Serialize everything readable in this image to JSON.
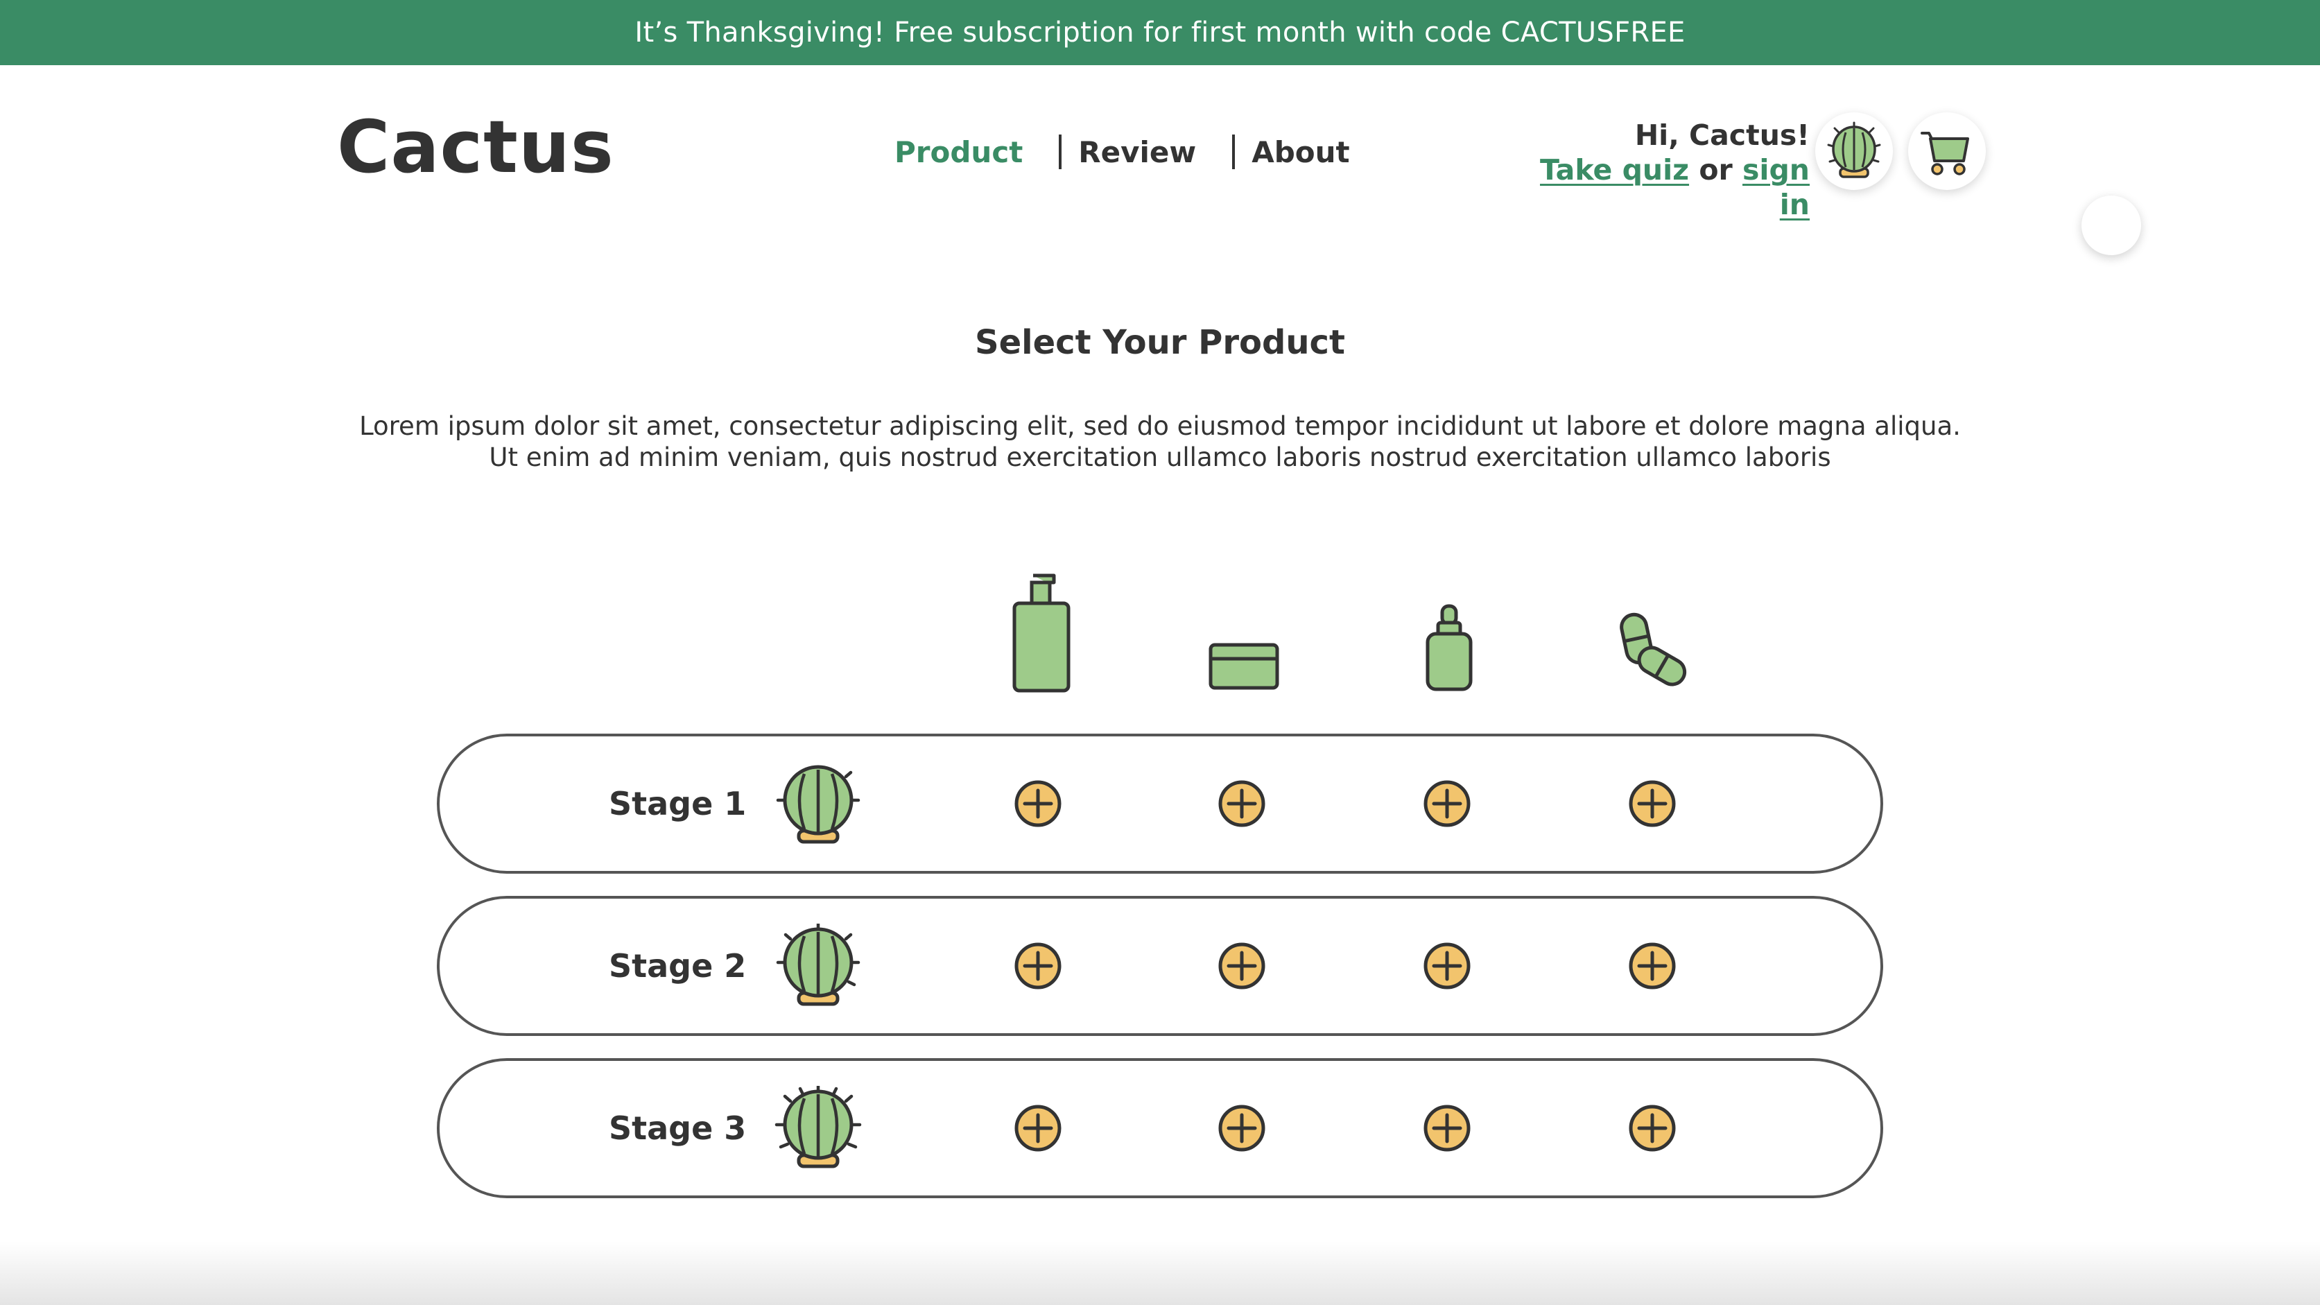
{
  "promo": {
    "text": "It’s Thanksgiving! Free subscription for first month with code CACTUSFREE"
  },
  "header": {
    "logo": "Cactus",
    "nav": [
      {
        "label": "Product",
        "active": true
      },
      {
        "label": "Review",
        "active": false
      },
      {
        "label": "About",
        "active": false
      }
    ],
    "greeting": "Hi, Cactus!",
    "quiz_link": "Take quiz",
    "or_text": "or",
    "signin_link": "sign in",
    "avatar_icon": "cactus-icon",
    "cart_icon": "cart-icon"
  },
  "main": {
    "title": "Select Your Product",
    "description": "Lorem ipsum dolor sit amet, consectetur adipiscing elit, sed do eiusmod tempor incididunt ut labore et dolore magna aliqua. Ut enim ad minim veniam, quis nostrud exercitation ullamco laboris nostrud exercitation ullamco laboris",
    "product_icons": [
      "pump-bottle-icon",
      "cream-jar-icon",
      "dropper-bottle-icon",
      "capsule-icon"
    ],
    "stages": [
      {
        "label": "Stage 1",
        "icon": "cactus-icon"
      },
      {
        "label": "Stage 2",
        "icon": "cactus-spiky-icon"
      },
      {
        "label": "Stage 3",
        "icon": "cactus-spikier-icon"
      }
    ],
    "add_icon": "plus-circle-icon"
  },
  "colors": {
    "brand_green": "#3a8c65",
    "plant_green": "#9ecb8a",
    "accent_yellow": "#f2c46d",
    "outline": "#333333"
  }
}
